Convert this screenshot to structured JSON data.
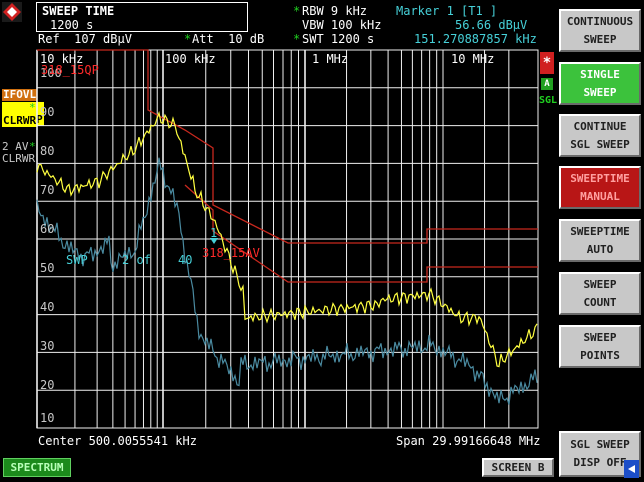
{
  "logo": "R&S",
  "sweep_box": {
    "label": "SWEEP TIME",
    "value": "1200 s"
  },
  "header": {
    "ref": "Ref  107 dBµV",
    "att_star": "*",
    "att": "Att  10 dB",
    "rbw_star": "*",
    "rbw": "RBW 9 kHz",
    "vbw": "VBW 100 kHz",
    "swt_star": "*",
    "swt": "SWT 1200 s",
    "marker_title": "Marker 1 [T1 ]",
    "marker_level": "56.66 dBµV",
    "marker_freq": "151.270887857 kHz"
  },
  "left_labels": {
    "ifovl": "IFOVL",
    "trace1_num": "1",
    "trace1_det": "QP",
    "trace1_mode": "CLRWR",
    "trace1_star": "*",
    "trace2": "2 AV",
    "trace2_star": "*",
    "trace2_mode": "CLRWR"
  },
  "right_indicators": {
    "star": "*",
    "a": "A",
    "sgl": "SGL"
  },
  "freq_labels": [
    "10 kHz",
    "100 kHz",
    "1 MHz",
    "10 MHz"
  ],
  "level_ticks": [
    "100",
    "90",
    "80",
    "70",
    "60",
    "50",
    "40",
    "30",
    "20",
    "10"
  ],
  "limit_labels": {
    "qp": "318_15QP",
    "av": "318_15AV"
  },
  "overlay": {
    "swp": "SWP",
    "count": "2 of",
    "total": "40",
    "marker_num": "1"
  },
  "footer": {
    "center": "Center 500.0055541 kHz",
    "span": "Span 29.99166648 MHz"
  },
  "softkeys": [
    {
      "line1": "CONTINUOUS",
      "line2": "SWEEP",
      "style": "gray"
    },
    {
      "line1": "SINGLE",
      "line2": "SWEEP",
      "style": "green"
    },
    {
      "line1": "CONTINUE",
      "line2": "SGL SWEEP",
      "style": "gray"
    },
    {
      "line1": "SWEEPTIME",
      "line2": "MANUAL",
      "style": "red"
    },
    {
      "line1": "SWEEPTIME",
      "line2": "AUTO",
      "style": "gray"
    },
    {
      "line1": "SWEEP",
      "line2": "COUNT",
      "style": "gray"
    },
    {
      "line1": "SWEEP",
      "line2": "POINTS",
      "style": "gray"
    },
    {
      "line1": "SGL SWEEP",
      "line2": "DISP OFF",
      "style": "gray"
    }
  ],
  "bottom_buttons": {
    "spectrum": "SPECTRUM",
    "screen": "SCREEN B"
  },
  "colors": {
    "grid": "#f0f0f0",
    "trace_qp": "#ffff40",
    "trace_av": "#4a8aa0",
    "limit": "#c8281e",
    "marker": "#46d0d8",
    "softkey": "#c8c8c8",
    "softkey_active": "#3cc23c",
    "softkey_alert": "#b81616"
  },
  "icons": [
    "logo-icon",
    "sgl-sweep-arrow-icon"
  ]
}
